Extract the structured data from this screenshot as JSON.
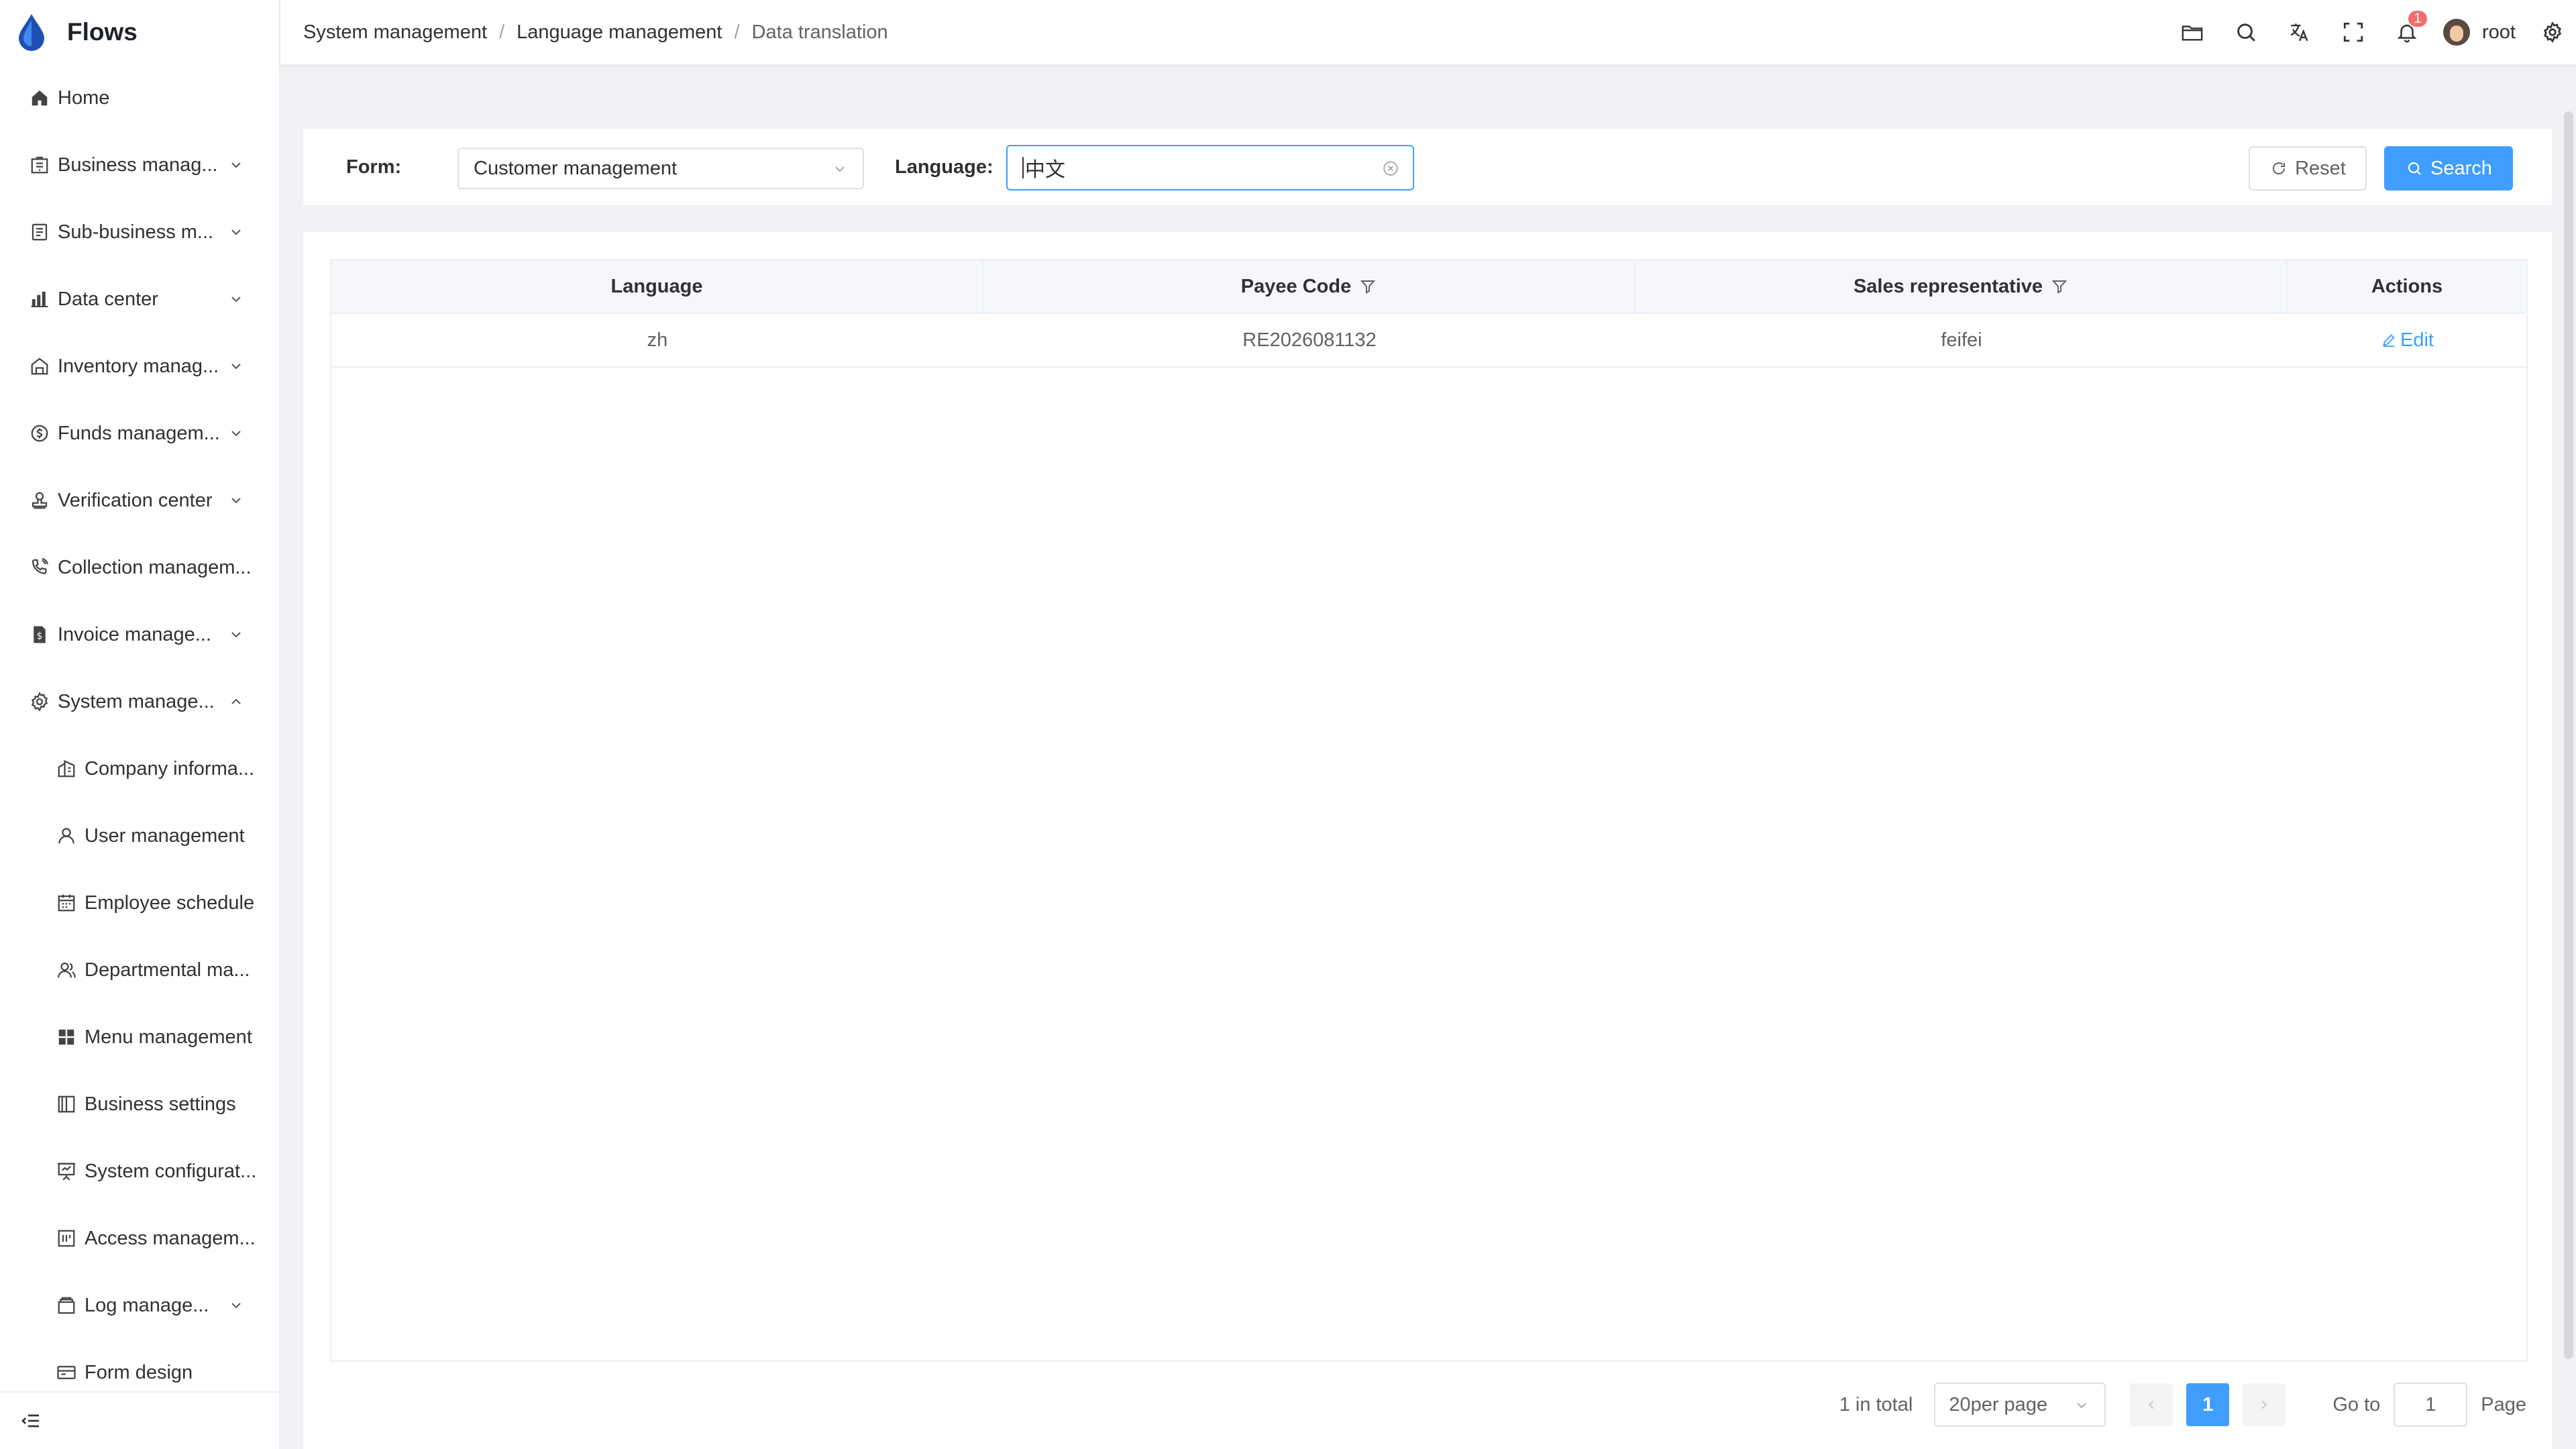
{
  "app": {
    "name": "Flows"
  },
  "sidebar": {
    "items": [
      {
        "label": "Home",
        "icon": "home-icon",
        "expandable": false
      },
      {
        "label": "Business manag...",
        "icon": "building-icon",
        "expandable": true
      },
      {
        "label": "Sub-business m...",
        "icon": "document-icon",
        "expandable": true
      },
      {
        "label": "Data center",
        "icon": "bar-chart-icon",
        "expandable": true
      },
      {
        "label": "Inventory manag...",
        "icon": "warehouse-icon",
        "expandable": true
      },
      {
        "label": "Funds managem...",
        "icon": "coin-icon",
        "expandable": true
      },
      {
        "label": "Verification center",
        "icon": "stamp-icon",
        "expandable": true
      },
      {
        "label": "Collection managem...",
        "icon": "phone-icon",
        "expandable": false
      },
      {
        "label": "Invoice manage...",
        "icon": "invoice-icon",
        "expandable": true
      },
      {
        "label": "System manage...",
        "icon": "gear-icon",
        "expandable": true,
        "expanded": true
      }
    ],
    "sub_items": [
      {
        "label": "Company informa...",
        "icon": "company-icon"
      },
      {
        "label": "User management",
        "icon": "user-icon"
      },
      {
        "label": "Employee schedule",
        "icon": "calendar-icon"
      },
      {
        "label": "Departmental ma...",
        "icon": "team-icon"
      },
      {
        "label": "Menu management",
        "icon": "grid-icon"
      },
      {
        "label": "Business settings",
        "icon": "book-icon"
      },
      {
        "label": "System configurat...",
        "icon": "presentation-icon"
      },
      {
        "label": "Access managem...",
        "icon": "access-icon"
      },
      {
        "label": "Log manage...",
        "icon": "log-icon",
        "expandable": true
      },
      {
        "label": "Form design",
        "icon": "form-icon"
      }
    ]
  },
  "breadcrumb": [
    "System management",
    "Language management",
    "Data translation"
  ],
  "header": {
    "notification_count": "1",
    "username": "root"
  },
  "filter": {
    "form_label": "Form:",
    "form_value": "Customer management",
    "language_label": "Language:",
    "language_value": "中文",
    "reset_label": "Reset",
    "search_label": "Search"
  },
  "table": {
    "columns": [
      "Language",
      "Payee Code",
      "Sales representative",
      "Actions"
    ],
    "rows": [
      {
        "language": "zh",
        "payee_code": "RE2026081132",
        "sales_rep": "feifei",
        "action": "Edit"
      }
    ]
  },
  "pagination": {
    "total": "1 in total",
    "page_size": "20per page",
    "current_page": "1",
    "goto_label": "Go to",
    "goto_value": "1",
    "page_suffix": "Page"
  },
  "colors": {
    "accent": "#409eff",
    "badge": "#f56c6c"
  }
}
